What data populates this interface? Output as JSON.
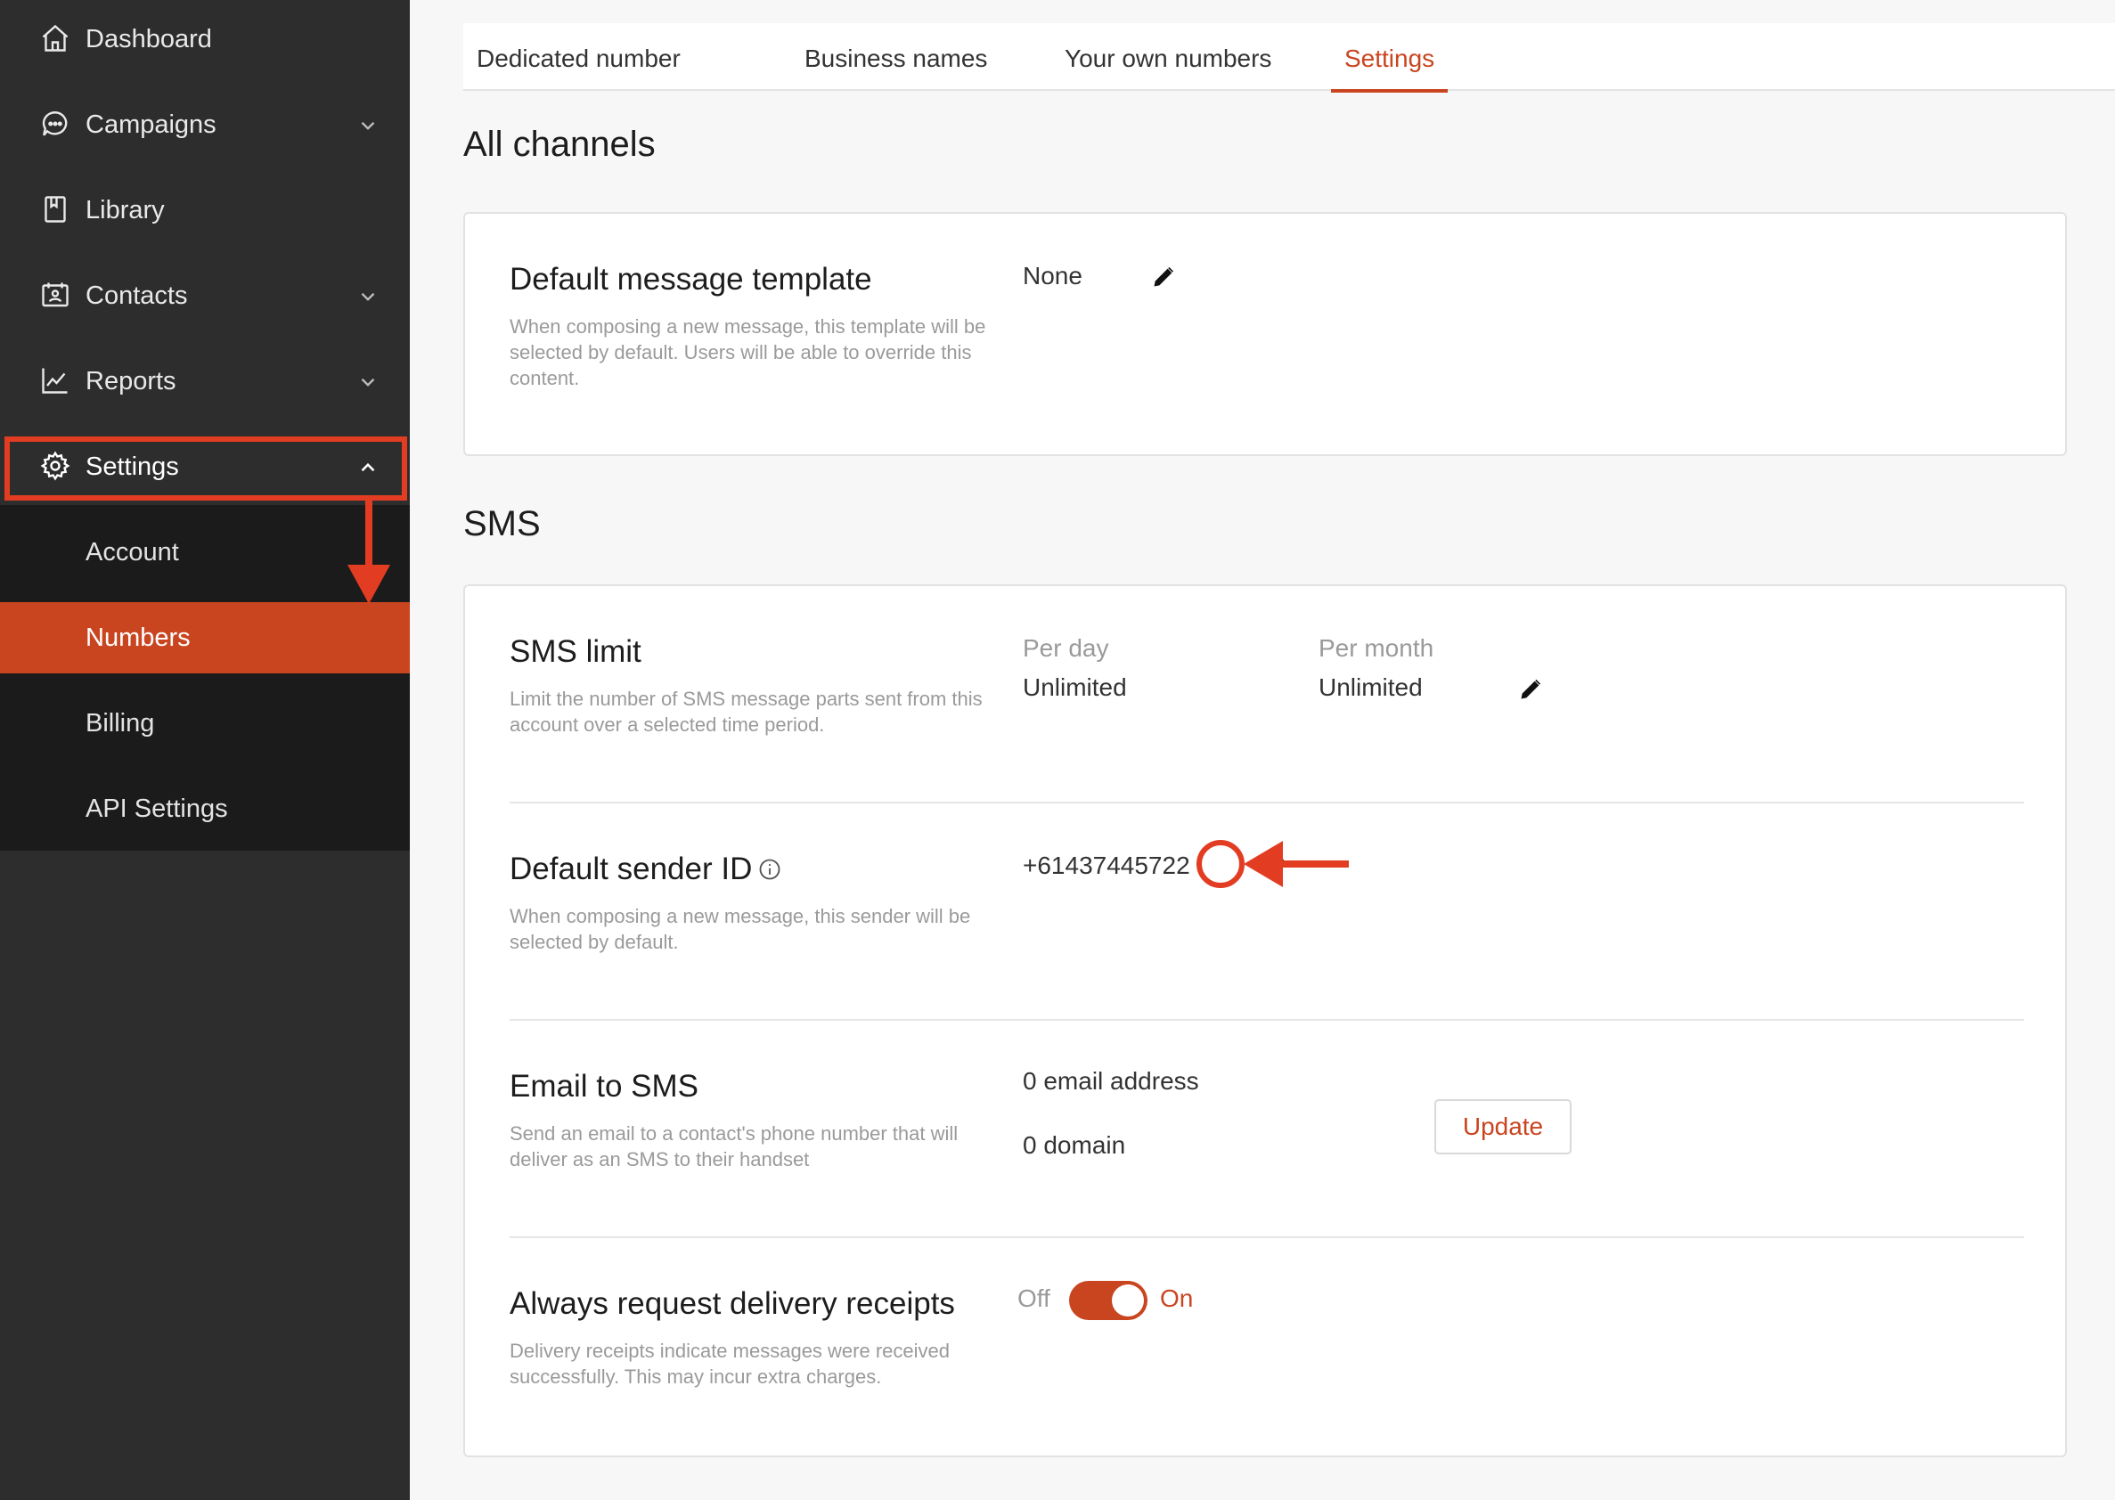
{
  "sidebar": {
    "items": [
      {
        "label": "Dashboard",
        "icon": "home-icon"
      },
      {
        "label": "Campaigns",
        "icon": "chat-bubble-icon"
      },
      {
        "label": "Library",
        "icon": "book-icon"
      },
      {
        "label": "Contacts",
        "icon": "contact-card-icon"
      },
      {
        "label": "Reports",
        "icon": "line-chart-icon"
      },
      {
        "label": "Settings",
        "icon": "gear-icon"
      }
    ],
    "submenu": [
      {
        "label": "Account"
      },
      {
        "label": "Numbers",
        "active": true
      },
      {
        "label": "Billing"
      },
      {
        "label": "API Settings"
      }
    ]
  },
  "tabs": [
    {
      "label": "Dedicated number"
    },
    {
      "label": "Business names"
    },
    {
      "label": "Your own numbers"
    },
    {
      "label": "Settings",
      "active": true
    }
  ],
  "all_channels": {
    "title": "All channels",
    "default_template": {
      "title": "Default message template",
      "description": "When composing a new message, this template will be selected by default. Users will be able to override this content.",
      "value": "None"
    }
  },
  "sms": {
    "title": "SMS",
    "limit": {
      "title": "SMS limit",
      "description": "Limit the number of SMS message parts sent from this account over a selected time period.",
      "per_day_label": "Per day",
      "per_day_value": "Unlimited",
      "per_month_label": "Per month",
      "per_month_value": "Unlimited"
    },
    "sender_id": {
      "title": "Default sender ID",
      "description": "When composing a new message, this sender will be selected by default.",
      "value": "+61437445722"
    },
    "email_to_sms": {
      "title": "Email to SMS",
      "description": "Send an email to a contact's phone number that will deliver as an SMS to their handset",
      "email_count": "0 email address",
      "domain_count": "0 domain",
      "update_label": "Update"
    },
    "delivery_receipts": {
      "title": "Always request delivery receipts",
      "description": "Delivery receipts indicate messages were received successfully. This may incur extra charges.",
      "off_label": "Off",
      "on_label": "On",
      "enabled": true
    }
  },
  "colors": {
    "accent": "#c94520",
    "annotation": "#e23d22",
    "sidebar_bg": "#2d2d2d",
    "submenu_bg": "#1b1b1b"
  }
}
